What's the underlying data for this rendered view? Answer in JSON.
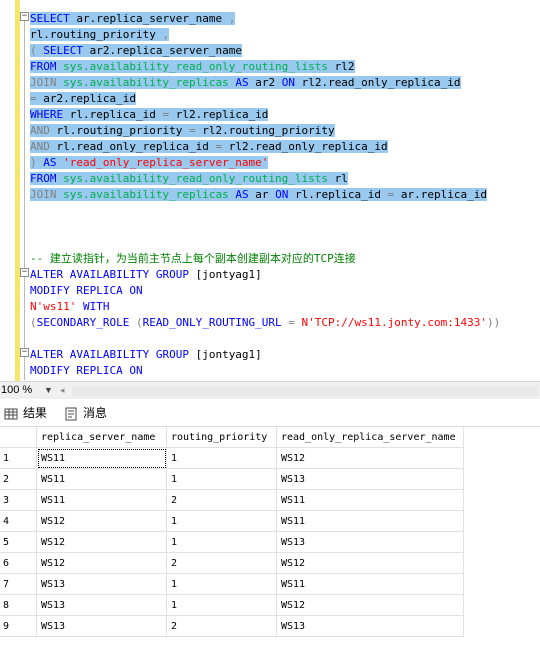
{
  "editor": {
    "lines": [
      {
        "sel": true,
        "tokens": [
          {
            "t": "SELECT",
            "c": "kw"
          },
          {
            "t": " ar.replica_server_name ",
            "c": "bl"
          },
          {
            "t": ",",
            "c": "op"
          }
        ]
      },
      {
        "sel": true,
        "tokens": [
          {
            "t": "rl.routing_priority ",
            "c": "bl"
          },
          {
            "t": ",",
            "c": "op"
          }
        ]
      },
      {
        "sel": true,
        "tokens": [
          {
            "t": "( ",
            "c": "op"
          },
          {
            "t": "SELECT",
            "c": "kw"
          },
          {
            "t": " ar2.replica_server_name",
            "c": "bl"
          }
        ]
      },
      {
        "sel": true,
        "tokens": [
          {
            "t": "FROM",
            "c": "kw"
          },
          {
            "t": " ",
            "c": "bl"
          },
          {
            "t": "sys.availability_read_only_routing_lists",
            "c": "fn"
          },
          {
            "t": " rl2",
            "c": "bl"
          }
        ]
      },
      {
        "sel": true,
        "tokens": [
          {
            "t": "JOIN",
            "c": "op"
          },
          {
            "t": " ",
            "c": "bl"
          },
          {
            "t": "sys.availability_replicas",
            "c": "fn"
          },
          {
            "t": " ",
            "c": "bl"
          },
          {
            "t": "AS",
            "c": "kw"
          },
          {
            "t": " ar2 ",
            "c": "bl"
          },
          {
            "t": "ON",
            "c": "kw"
          },
          {
            "t": " rl2.read_only_replica_id",
            "c": "bl"
          }
        ]
      },
      {
        "sel": true,
        "tokens": [
          {
            "t": "=",
            "c": "op"
          },
          {
            "t": " ar2.replica_id",
            "c": "bl"
          }
        ]
      },
      {
        "sel": true,
        "tokens": [
          {
            "t": "WHERE",
            "c": "kw"
          },
          {
            "t": " rl.replica_id ",
            "c": "bl"
          },
          {
            "t": "=",
            "c": "op"
          },
          {
            "t": " rl2.replica_id",
            "c": "bl"
          }
        ]
      },
      {
        "sel": true,
        "tokens": [
          {
            "t": "AND",
            "c": "op"
          },
          {
            "t": " rl.routing_priority ",
            "c": "bl"
          },
          {
            "t": "=",
            "c": "op"
          },
          {
            "t": " rl2.routing_priority",
            "c": "bl"
          }
        ]
      },
      {
        "sel": true,
        "tokens": [
          {
            "t": "AND",
            "c": "op"
          },
          {
            "t": " rl.read_only_replica_id ",
            "c": "bl"
          },
          {
            "t": "=",
            "c": "op"
          },
          {
            "t": " rl2.read_only_replica_id",
            "c": "bl"
          }
        ]
      },
      {
        "sel": true,
        "tokens": [
          {
            "t": ") ",
            "c": "op"
          },
          {
            "t": "AS",
            "c": "kw"
          },
          {
            "t": " ",
            "c": "bl"
          },
          {
            "t": "'read_only_replica_server_name'",
            "c": "str"
          }
        ]
      },
      {
        "sel": true,
        "tokens": [
          {
            "t": "FROM",
            "c": "kw"
          },
          {
            "t": " ",
            "c": "bl"
          },
          {
            "t": "sys.availability_read_only_routing_lists",
            "c": "fn"
          },
          {
            "t": " rl",
            "c": "bl"
          }
        ]
      },
      {
        "sel": true,
        "tokens": [
          {
            "t": "JOIN",
            "c": "op"
          },
          {
            "t": " ",
            "c": "bl"
          },
          {
            "t": "sys.availability_replicas",
            "c": "fn"
          },
          {
            "t": " ",
            "c": "bl"
          },
          {
            "t": "AS",
            "c": "kw"
          },
          {
            "t": " ar ",
            "c": "bl"
          },
          {
            "t": "ON",
            "c": "kw"
          },
          {
            "t": " rl.replica_id ",
            "c": "bl"
          },
          {
            "t": "=",
            "c": "op"
          },
          {
            "t": " ar.replica_id",
            "c": "bl"
          }
        ]
      },
      {
        "sel": false,
        "tokens": []
      },
      {
        "sel": false,
        "tokens": []
      },
      {
        "sel": false,
        "tokens": []
      },
      {
        "sel": false,
        "tokens": [
          {
            "t": "-- 建立读指针，为当前主节点上每个副本创建副本对应的TCP连接",
            "c": "cm"
          }
        ]
      },
      {
        "sel": false,
        "tokens": [
          {
            "t": "ALTER AVAILABILITY GROUP",
            "c": "kw"
          },
          {
            "t": " [jontyag1]",
            "c": "bl"
          }
        ]
      },
      {
        "sel": false,
        "tokens": [
          {
            "t": "MODIFY REPLICA ON",
            "c": "kw"
          }
        ]
      },
      {
        "sel": false,
        "tokens": [
          {
            "t": "N'ws11'",
            "c": "str"
          },
          {
            "t": " ",
            "c": "bl"
          },
          {
            "t": "WITH",
            "c": "kw"
          }
        ]
      },
      {
        "sel": false,
        "tokens": [
          {
            "t": "(",
            "c": "op"
          },
          {
            "t": "SECONDARY_ROLE",
            "c": "kw"
          },
          {
            "t": " ",
            "c": "bl"
          },
          {
            "t": "(",
            "c": "op"
          },
          {
            "t": "READ_ONLY_ROUTING_URL",
            "c": "kw"
          },
          {
            "t": " ",
            "c": "bl"
          },
          {
            "t": "=",
            "c": "op"
          },
          {
            "t": " ",
            "c": "bl"
          },
          {
            "t": "N'TCP://ws11.jonty.com:1433'",
            "c": "str"
          },
          {
            "t": "))",
            "c": "op"
          }
        ]
      },
      {
        "sel": false,
        "tokens": []
      },
      {
        "sel": false,
        "tokens": [
          {
            "t": "ALTER AVAILABILITY GROUP",
            "c": "kw"
          },
          {
            "t": " [jontyag1]",
            "c": "bl"
          }
        ]
      },
      {
        "sel": false,
        "tokens": [
          {
            "t": "MODIFY REPLICA ON",
            "c": "kw"
          }
        ]
      }
    ]
  },
  "statusbar": {
    "zoom": "100 %"
  },
  "tabs": {
    "results_label": "结果",
    "messages_label": "消息"
  },
  "grid": {
    "columns": [
      "replica_server_name",
      "routing_priority",
      "read_only_replica_server_name"
    ],
    "rows": [
      [
        "1",
        "WS11",
        "1",
        "WS12"
      ],
      [
        "2",
        "WS11",
        "1",
        "WS13"
      ],
      [
        "3",
        "WS11",
        "2",
        "WS11"
      ],
      [
        "4",
        "WS12",
        "1",
        "WS11"
      ],
      [
        "5",
        "WS12",
        "1",
        "WS13"
      ],
      [
        "6",
        "WS12",
        "2",
        "WS12"
      ],
      [
        "7",
        "WS13",
        "1",
        "WS11"
      ],
      [
        "8",
        "WS13",
        "1",
        "WS12"
      ],
      [
        "9",
        "WS13",
        "2",
        "WS13"
      ]
    ]
  }
}
